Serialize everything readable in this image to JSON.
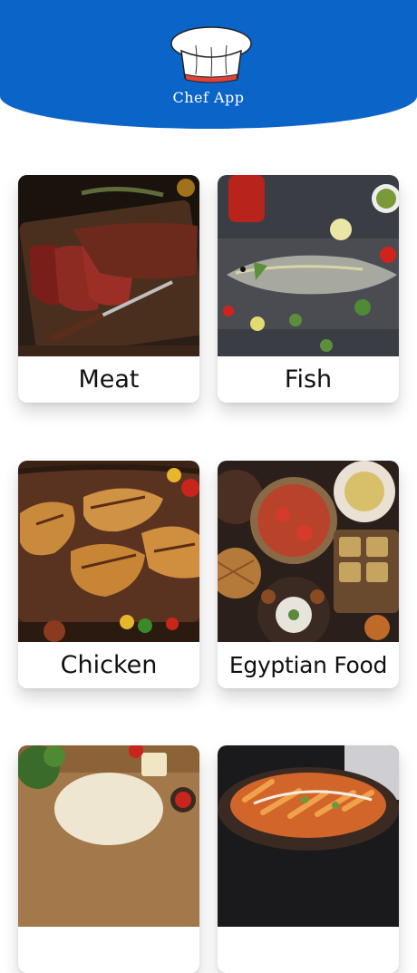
{
  "header": {
    "background_color": "#0b64c8",
    "logo_icon": "chef-hat-icon",
    "title": "Chef App"
  },
  "categories": [
    {
      "label": "Meat",
      "image": "steak-photo"
    },
    {
      "label": "Fish",
      "image": "fish-photo"
    },
    {
      "label": "Chicken",
      "image": "grilled-chicken-photo"
    },
    {
      "label": "Egyptian Food",
      "image": "egyptian-food-photo"
    },
    {
      "label": "",
      "image": "pizza-dough-photo"
    },
    {
      "label": "",
      "image": "pasta-photo"
    }
  ]
}
